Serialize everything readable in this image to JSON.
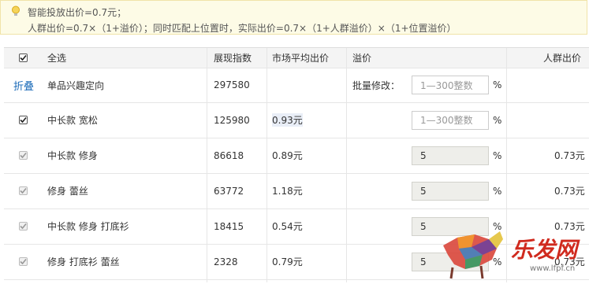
{
  "tip": {
    "line1": "智能投放出价=0.7元；",
    "line2": "人群出价=0.7×（1+溢价）；同时匹配上位置时，实际出价=0.7×（1+人群溢价）×（1+位置溢价）"
  },
  "header": {
    "select_all": "全选",
    "impressions": "展现指数",
    "market_avg": "市场平均出价",
    "premium": "溢价",
    "crowd_price": "人群出价"
  },
  "group": {
    "toggle": "折叠",
    "name": "单品兴趣定向",
    "impressions": "297580",
    "batch_label": "批量修改：",
    "batch_placeholder": "1—300整数",
    "percent": "%"
  },
  "rows": [
    {
      "name": "中长款 宽松",
      "impressions": "125980",
      "avg": "0.93元",
      "premium": "",
      "placeholder": "1—300整数",
      "percent": "%",
      "crowd": ""
    },
    {
      "name": "中长款 修身",
      "impressions": "86618",
      "avg": "0.89元",
      "premium": "5",
      "placeholder": "",
      "percent": "%",
      "crowd": "0.73元"
    },
    {
      "name": "修身 蕾丝",
      "impressions": "63772",
      "avg": "1.18元",
      "premium": "5",
      "placeholder": "",
      "percent": "%",
      "crowd": "0.73元"
    },
    {
      "name": "中长款 修身 打底衫",
      "impressions": "18415",
      "avg": "0.54元",
      "premium": "5",
      "placeholder": "",
      "percent": "%",
      "crowd": "0.73元"
    },
    {
      "name": "修身 打底衫 蕾丝",
      "impressions": "2328",
      "avg": "0.79元",
      "premium": "5",
      "placeholder": "",
      "percent": "%",
      "crowd": "0.73元"
    }
  ],
  "watermark": {
    "brand": "乐发网",
    "url": "www.lfpf.cn"
  }
}
